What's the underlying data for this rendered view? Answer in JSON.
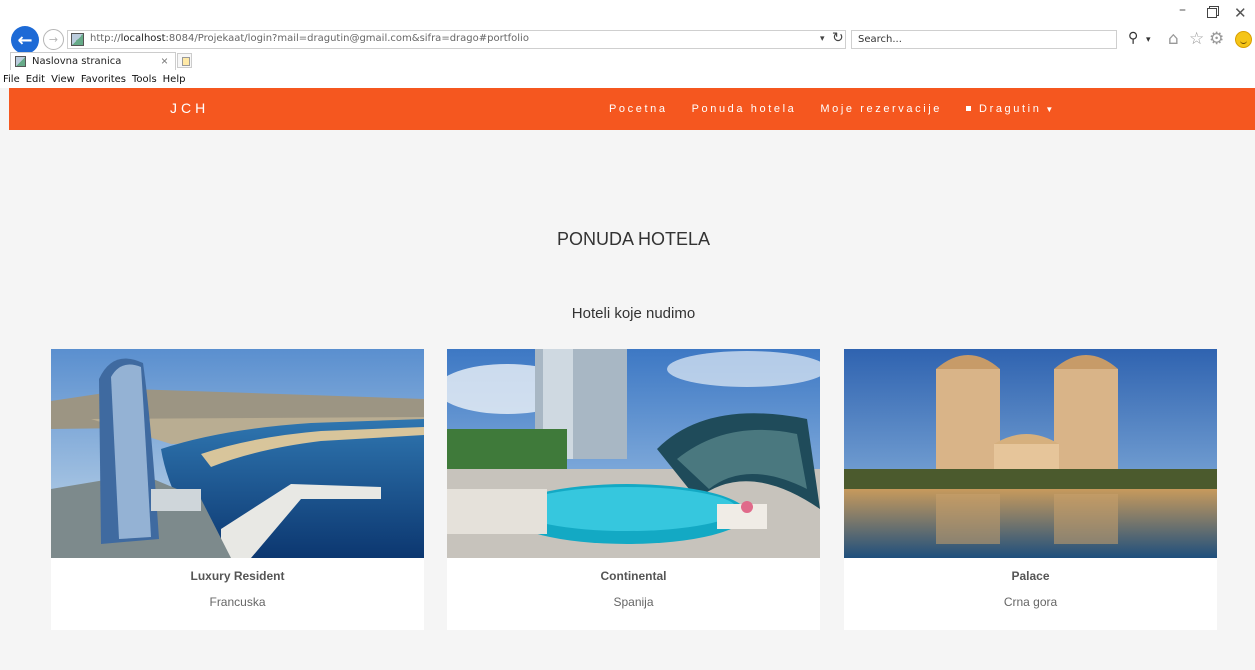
{
  "browser": {
    "url_prefix": "http://",
    "url_host": "localhost",
    "url_rest": ":8084/Projekaat/login?mail=dragutin@gmail.com&sifra=drago#portfolio",
    "search_placeholder": "Search...",
    "tab_title": "Naslovna stranica",
    "menu": [
      "File",
      "Edit",
      "View",
      "Favorites",
      "Tools",
      "Help"
    ]
  },
  "navbar": {
    "brand": "JCH",
    "links": [
      "Pocetna",
      "Ponuda hotela",
      "Moje rezervacije"
    ],
    "user": "Dragutin",
    "accent_color": "#f5571f"
  },
  "main": {
    "title": "PONUDA HOTELA",
    "subtitle": "Hoteli koje nudimo",
    "hotels": [
      {
        "name": "Luxury Resident",
        "country": "Francuska"
      },
      {
        "name": "Continental",
        "country": "Spanija"
      },
      {
        "name": "Palace",
        "country": "Crna gora"
      }
    ]
  }
}
